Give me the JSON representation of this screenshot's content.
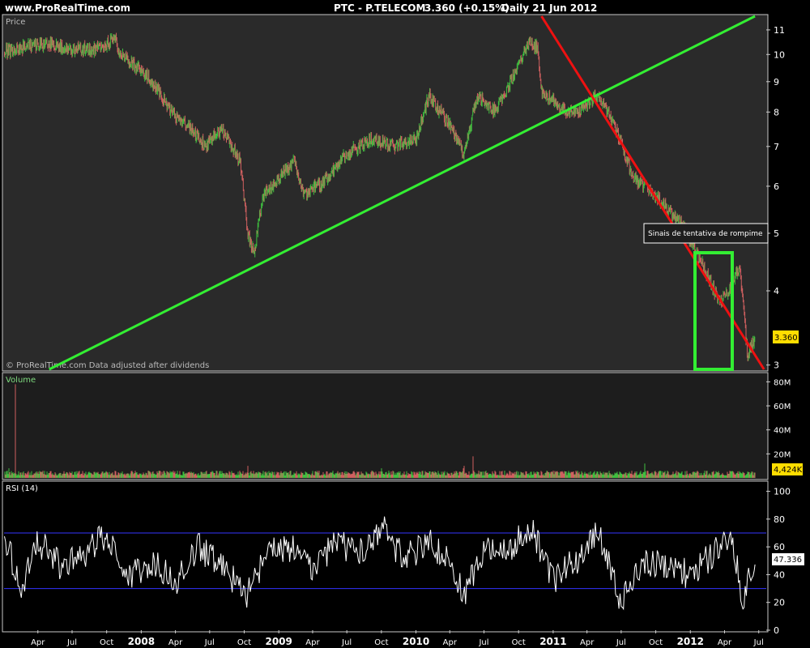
{
  "header": {
    "site": "www.ProRealTime.com",
    "ticker": "PTC - P.TELECOM",
    "quote": "3.360 (+0.15%)",
    "period": "Daily 21 Jun 2012"
  },
  "colors": {
    "background": "#000000",
    "panel_bg": "#2a2a2a",
    "up": "#3fbf3f",
    "down": "#d06060",
    "trend_green": "#33ee33",
    "trend_red": "#ee1111",
    "rsi_line": "#ffffff",
    "rsi_guides": "#3333ff",
    "price_tag": "#ffdd00"
  },
  "price_panel": {
    "label": "Price",
    "watermark": "© ProRealTime.com  Data adjusted after dividends",
    "annotation": "Sinais de tentativa de rompime",
    "current_price": "3.360",
    "y_ticks": [
      "11",
      "10",
      "9",
      "8",
      "7",
      "6",
      "5",
      "4",
      "3"
    ]
  },
  "volume_panel": {
    "label": "Volume",
    "current": "4,424K",
    "y_ticks": [
      "80M",
      "60M",
      "40M",
      "20M"
    ]
  },
  "rsi_panel": {
    "label": "RSI (14)",
    "current": "47.336",
    "y_ticks": [
      "100",
      "80",
      "60",
      "40",
      "20",
      "0"
    ]
  },
  "x_axis": {
    "ticks": [
      "Apr",
      "Jul",
      "Oct",
      "2008",
      "Apr",
      "Jul",
      "Oct",
      "2009",
      "Apr",
      "Jul",
      "Oct",
      "2010",
      "Apr",
      "Jul",
      "Oct",
      "2011",
      "Apr",
      "Jul",
      "Oct",
      "2012",
      "Apr",
      "Jul"
    ]
  },
  "chart_data": [
    {
      "type": "candlestick",
      "title": "PTC - P.TELECOM",
      "scale": "log",
      "ylim": [
        2.95,
        11.6
      ],
      "x_range": [
        "2007-01-01",
        "2012-07-21"
      ],
      "series": [
        {
          "dates": [
            "2007-01-02",
            "2007-03-01",
            "2007-05-01",
            "2007-07-01",
            "2007-09-01",
            "2007-10-25",
            "2007-11-05",
            "2008-01-01",
            "2008-02-15",
            "2008-03-20",
            "2008-05-01",
            "2008-06-20",
            "2008-08-01",
            "2008-09-20",
            "2008-10-10",
            "2008-10-28",
            "2008-11-20",
            "2009-01-01",
            "2009-02-10",
            "2009-03-10",
            "2009-05-01",
            "2009-07-01",
            "2009-09-01",
            "2009-11-01",
            "2010-01-01",
            "2010-02-05",
            "2010-04-01",
            "2010-05-07",
            "2010-06-15",
            "2010-08-01",
            "2010-10-01",
            "2010-11-01",
            "2010-11-20",
            "2010-12-01",
            "2011-01-05",
            "2011-02-15",
            "2011-03-20",
            "2011-05-01",
            "2011-06-15",
            "2011-08-01",
            "2011-09-15",
            "2011-11-01",
            "2011-12-15",
            "2012-01-20",
            "2012-02-20",
            "2012-03-20",
            "2012-04-20",
            "2012-05-10",
            "2012-06-01",
            "2012-06-21"
          ],
          "close": [
            10.1,
            10.3,
            10.4,
            10.2,
            10.2,
            10.6,
            10.0,
            9.4,
            8.7,
            8.0,
            7.6,
            7.0,
            7.5,
            6.6,
            5.0,
            4.6,
            5.8,
            6.2,
            6.6,
            5.8,
            6.1,
            6.8,
            7.2,
            7.0,
            7.2,
            8.5,
            7.6,
            6.8,
            8.5,
            8.0,
            9.6,
            10.6,
            10.2,
            8.7,
            8.3,
            8.0,
            8.1,
            8.6,
            7.5,
            6.2,
            5.9,
            5.5,
            5.1,
            4.6,
            4.2,
            3.8,
            4.1,
            4.4,
            3.1,
            3.36
          ]
        },
        {
          "name": "Volume",
          "dates": [
            "2007-01-15",
            "2007-02-01",
            "2007-06-01",
            "2007-10-01",
            "2008-01-20",
            "2008-06-01",
            "2008-10-10",
            "2009-03-01",
            "2009-06-01",
            "2009-10-01",
            "2010-01-01",
            "2010-05-07",
            "2010-05-10",
            "2010-06-01",
            "2010-11-01",
            "2011-01-01",
            "2011-06-01",
            "2011-09-01",
            "2012-01-01",
            "2012-05-15",
            "2012-06-21"
          ],
          "values": [
            8,
            78,
            4,
            5,
            6,
            4,
            10,
            5,
            4,
            8,
            5,
            8,
            10,
            18,
            5,
            6,
            4,
            12,
            4,
            4,
            4.42
          ]
        },
        {
          "name": "RSI (14)",
          "dates": [
            "2007-01-02",
            "2007-02-15",
            "2007-04-01",
            "2007-06-01",
            "2007-08-01",
            "2007-10-01",
            "2007-12-01",
            "2008-02-01",
            "2008-04-01",
            "2008-06-01",
            "2008-08-01",
            "2008-10-10",
            "2008-12-01",
            "2009-02-01",
            "2009-04-01",
            "2009-06-01",
            "2009-08-01",
            "2009-10-01",
            "2009-12-01",
            "2010-02-01",
            "2010-04-01",
            "2010-05-10",
            "2010-07-01",
            "2010-09-01",
            "2010-11-01",
            "2011-01-01",
            "2011-03-01",
            "2011-05-01",
            "2011-07-01",
            "2011-09-01",
            "2011-11-01",
            "2012-01-01",
            "2012-03-01",
            "2012-04-20",
            "2012-05-20",
            "2012-06-21"
          ],
          "values": [
            70,
            30,
            65,
            45,
            55,
            70,
            40,
            50,
            35,
            60,
            45,
            25,
            55,
            60,
            40,
            65,
            55,
            75,
            50,
            65,
            50,
            25,
            60,
            55,
            75,
            35,
            50,
            70,
            20,
            50,
            45,
            40,
            55,
            68,
            22,
            47.336
          ]
        }
      ],
      "trendlines": [
        {
          "color": "green",
          "points": [
            [
              "2007-05-01",
              2.95
            ],
            [
              "2012-06-21",
              11.6
            ]
          ]
        },
        {
          "color": "red",
          "points": [
            [
              "2010-12-01",
              11.6
            ],
            [
              "2012-07-15",
              2.95
            ]
          ]
        }
      ]
    }
  ]
}
